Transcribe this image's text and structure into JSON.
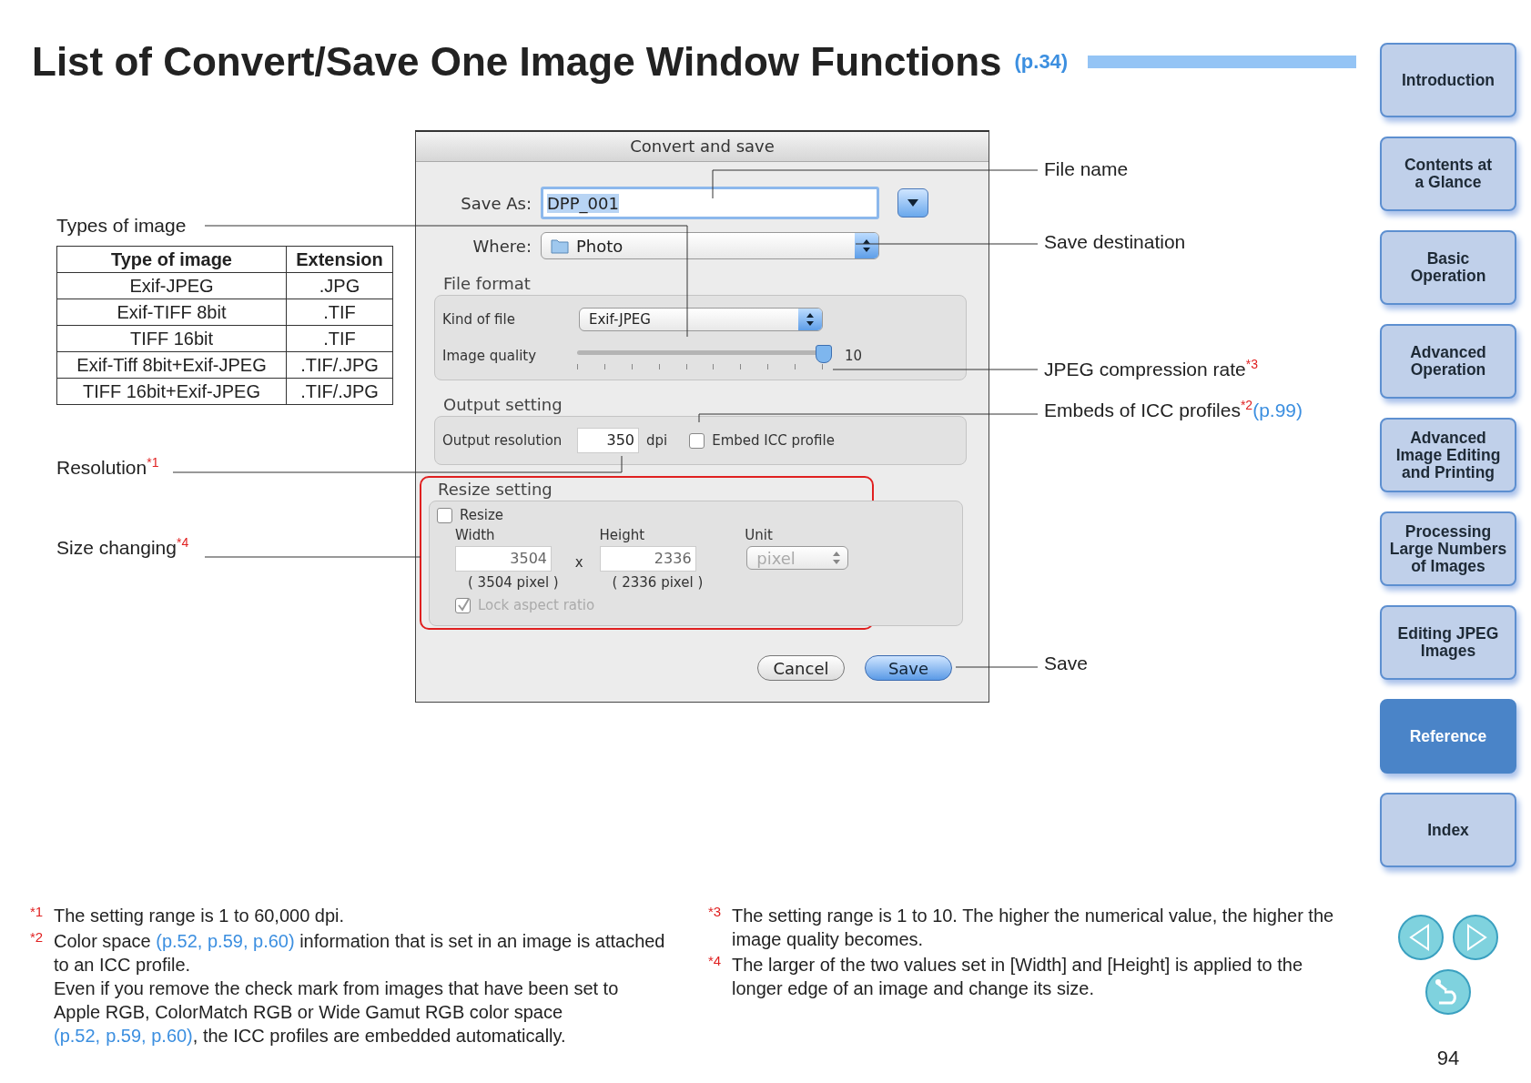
{
  "title": {
    "text": "List of Convert/Save One Image Window Functions",
    "link": "(p.34)"
  },
  "dialog": {
    "title": "Convert and save",
    "save_as": {
      "label": "Save As:",
      "value": "DPP_001"
    },
    "where": {
      "label": "Where:",
      "value": "Photo"
    },
    "file_format": {
      "heading": "File format",
      "kind_label": "Kind of file",
      "kind_value": "Exif-JPEG",
      "quality": {
        "label": "Image quality",
        "level": 1,
        "reading": "10"
      }
    },
    "output": {
      "heading": "Output setting",
      "resolution_label": "Output resolution",
      "resolution_value": "350",
      "unit": "dpi",
      "embed_label": "Embed ICC profile",
      "embed_checked": false
    },
    "resize": {
      "heading": "Resize setting",
      "resize_label": "Resize",
      "resize_checked": false,
      "width_label": "Width",
      "width_value": "3504",
      "times": "x",
      "height_label": "Height",
      "height_value": "2336",
      "unit_label": "Unit",
      "unit_value": "pixel",
      "width_pixels": "( 3504 pixel )",
      "height_pixels": "( 2336 pixel )",
      "lock_label": "Lock aspect ratio",
      "lock_checked": true,
      "lock_disabled": true
    },
    "buttons": [
      {
        "label": "Cancel",
        "default": false
      },
      {
        "label": "Save",
        "default": true
      }
    ]
  },
  "table": {
    "columns": [
      "Type of image",
      "Extension"
    ],
    "rows": [
      [
        "Exif-JPEG",
        ".JPG"
      ],
      [
        "Exif-TIFF 8bit",
        ".TIF"
      ],
      [
        "TIFF 16bit",
        ".TIF"
      ],
      [
        "Exif-Tiff 8bit+Exif-JPEG",
        ".TIF/.JPG"
      ],
      [
        "TIFF 16bit+Exif-JPEG",
        ".TIF/.JPG"
      ]
    ]
  },
  "left_callouts": [
    {
      "label": "Types of image"
    },
    {
      "label": "Resolution",
      "mark": "*1"
    },
    {
      "label": "Size changing",
      "mark": "*4"
    }
  ],
  "right_callouts": [
    {
      "label": "File name"
    },
    {
      "label": "Save destination"
    },
    {
      "label": "JPEG compression rate",
      "mark": "*3"
    },
    {
      "label": "Embeds of ICC profiles",
      "mark": "*2",
      "link": "(p.99)"
    },
    {
      "label": "Save"
    }
  ],
  "footnotes": [
    {
      "mark": "*1",
      "paragraphs": [
        [
          {
            "text": "The setting range is 1 to 60,000 dpi."
          }
        ]
      ]
    },
    {
      "mark": "*2",
      "paragraphs": [
        [
          {
            "text": "Color space "
          },
          {
            "text": "(p.52, p.59, p.60)",
            "link": true
          },
          {
            "text": " information that is set in an image is attached to an ICC profile."
          }
        ],
        [
          {
            "text": "Even if you remove the check mark from images that have been set to Apple RGB, ColorMatch RGB or Wide Gamut RGB color space "
          },
          {
            "text": "(p.52,",
            "link": true
          },
          {
            "text": "p.59, p.60)",
            "link": true
          },
          {
            "text": ", the ICC profiles are embedded automatically."
          }
        ]
      ]
    },
    {
      "mark": "*3",
      "paragraphs": [
        [
          {
            "text": "The setting range is 1 to 10. The higher the numerical value, the higher the image quality becomes."
          }
        ]
      ]
    },
    {
      "mark": "*4",
      "paragraphs": [
        [
          {
            "text": "The larger of the two values set in [Width] and [Height] is applied to the longer edge of an image and change its size."
          }
        ]
      ]
    }
  ],
  "sidebar": {
    "items": [
      {
        "label": "Introduction",
        "selected": false
      },
      {
        "label": "Contents at\na Glance",
        "selected": false
      },
      {
        "label": "Basic\nOperation",
        "selected": false
      },
      {
        "label": "Advanced\nOperation",
        "selected": false
      },
      {
        "label": "Advanced\nImage Editing\nand Printing",
        "selected": false
      },
      {
        "label": "Processing\nLarge Numbers\nof Images",
        "selected": false
      },
      {
        "label": "Editing JPEG\nImages",
        "selected": false
      },
      {
        "label": "Reference",
        "selected": true
      },
      {
        "label": "Index",
        "selected": false
      }
    ]
  },
  "page_number": "94"
}
